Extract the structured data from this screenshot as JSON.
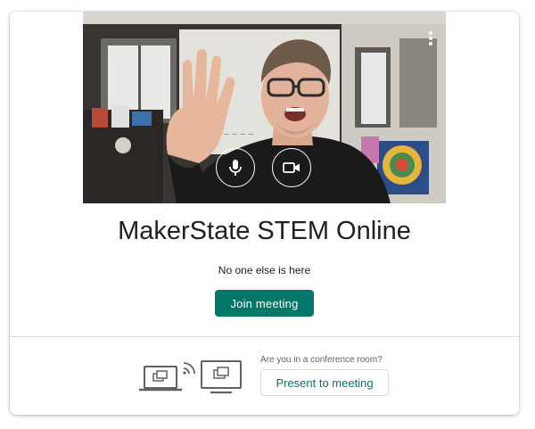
{
  "meeting": {
    "title": "MakerState STEM Online",
    "status": "No one else is here",
    "join_label": "Join meeting"
  },
  "conference": {
    "question": "Are you in a conference room?",
    "present_label": "Present to meeting"
  },
  "video": {
    "mic_state": "on",
    "camera_state": "on"
  },
  "icons": {
    "more": "more-vert-icon",
    "mic": "mic-icon",
    "camera": "videocam-icon",
    "laptop": "laptop-cast-icon",
    "wifi": "wireless-icon",
    "monitor": "monitor-present-icon"
  },
  "colors": {
    "accent": "#00796b",
    "title_text": "#202124",
    "secondary_text": "#5f6368",
    "divider": "#dadce0"
  }
}
